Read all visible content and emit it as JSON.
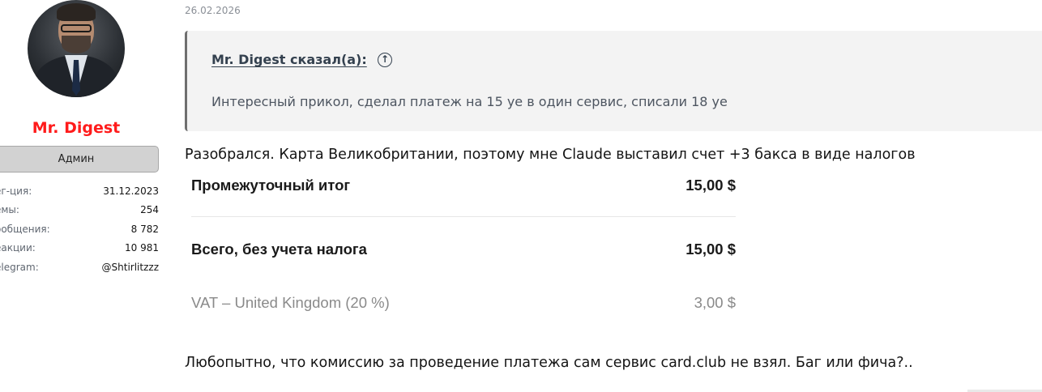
{
  "user": {
    "name": "Mr. Digest",
    "role": "Админ",
    "stats": [
      {
        "label": "ег-ция:",
        "value": "31.12.2023"
      },
      {
        "label": "емы:",
        "value": "254"
      },
      {
        "label": "ообщения:",
        "value": "8 782"
      },
      {
        "label": "еакции:",
        "value": "10 981"
      },
      {
        "label": "elegram:",
        "value": "@Shtirlitzzz"
      }
    ],
    "name_color": "#ff1b1b"
  },
  "post": {
    "date": "26.02.2026",
    "quote": {
      "author": "Mr. Digest сказал(а):",
      "text": "Интересный прикол, сделал платеж на 15 уе в один сервис, списали 18 уе"
    },
    "paragraph_1": "Разобрался. Карта Великобритании, поэтому мне Claude выставил счет +3 бакса в виде налогов",
    "invoice": {
      "rows": [
        {
          "label": "Промежуточный итог",
          "amount": "15,00 $"
        },
        {
          "label": "Всего, без учета налога",
          "amount": "15,00 $"
        },
        {
          "label": "VAT – United Kingdom (20 %)",
          "amount": "3,00 $"
        }
      ]
    },
    "paragraph_2": "Любопытно, что комиссию за проведение платежа сам сервис card.club не взял. Баг или фича?.."
  },
  "icons": {
    "quote_jump": "arrow-up-circle-icon"
  }
}
